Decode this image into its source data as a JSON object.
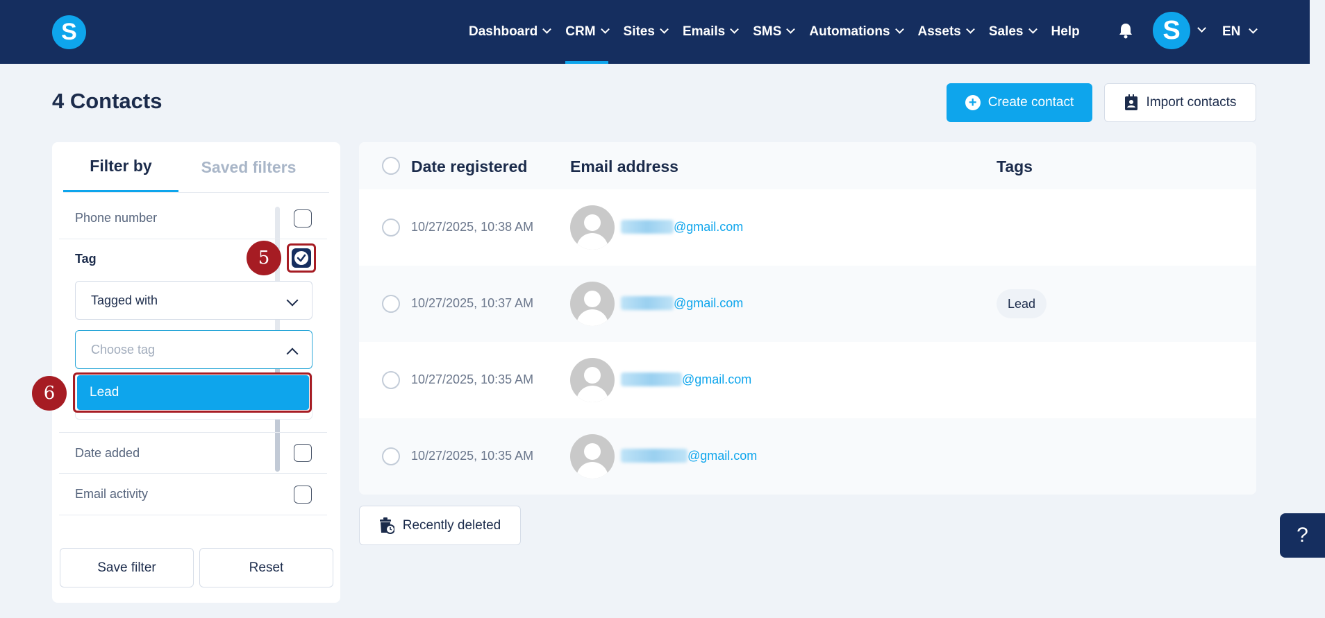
{
  "nav": {
    "items": [
      {
        "label": "Dashboard",
        "has_menu": true
      },
      {
        "label": "CRM",
        "has_menu": true,
        "active": true
      },
      {
        "label": "Sites",
        "has_menu": true
      },
      {
        "label": "Emails",
        "has_menu": true
      },
      {
        "label": "SMS",
        "has_menu": true
      },
      {
        "label": "Automations",
        "has_menu": true
      },
      {
        "label": "Assets",
        "has_menu": true
      },
      {
        "label": "Sales",
        "has_menu": true
      },
      {
        "label": "Help",
        "has_menu": false
      }
    ],
    "logo_letter": "S",
    "avatar_letter": "S",
    "language": "EN"
  },
  "header": {
    "title": "4 Contacts",
    "create_label": "Create contact",
    "import_label": "Import contacts"
  },
  "filter": {
    "tab_filter": "Filter by",
    "tab_saved": "Saved filters",
    "phone_label": "Phone number",
    "tag_label": "Tag",
    "tag_checked": true,
    "tagged_with": "Tagged with",
    "choose_placeholder": "Choose tag",
    "option_lead": "Lead",
    "date_added": "Date added",
    "email_activity": "Email activity",
    "save_label": "Save filter",
    "reset_label": "Reset"
  },
  "markers": {
    "m5": "5",
    "m6": "6"
  },
  "table": {
    "columns": {
      "date": "Date registered",
      "email": "Email address",
      "tags": "Tags"
    },
    "rows": [
      {
        "date": "10/27/2025, 10:38 AM",
        "email_domain": "@gmail.com",
        "tag": ""
      },
      {
        "date": "10/27/2025, 10:37 AM",
        "email_domain": "@gmail.com",
        "tag": "Lead"
      },
      {
        "date": "10/27/2025, 10:35 AM",
        "email_domain": "@gmail.com",
        "tag": ""
      },
      {
        "date": "10/27/2025, 10:35 AM",
        "email_domain": "@gmail.com",
        "tag": ""
      }
    ]
  },
  "recently_deleted_label": "Recently deleted",
  "help_label": "?",
  "colors": {
    "navy": "#152e5f",
    "accent": "#0ea5ec",
    "marker": "#a61c23"
  }
}
